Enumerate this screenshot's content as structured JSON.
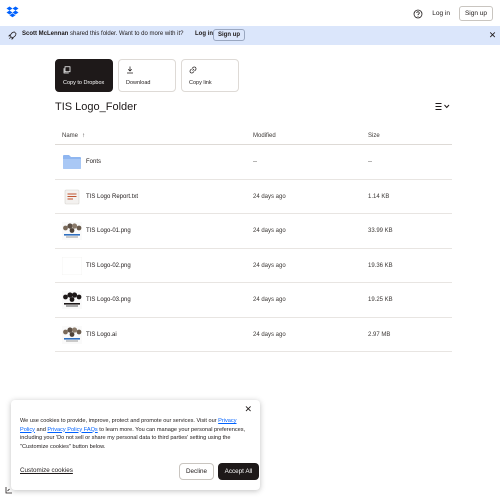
{
  "header": {
    "logo_icon": "dropbox-logo-icon",
    "help_icon": "help-circle-icon",
    "login_label": "Log in",
    "signup_label": "Sign up"
  },
  "banner": {
    "icon": "rocket-icon",
    "sharer": "Scott McLennan",
    "message": " shared this folder. Want to do more with it?",
    "login_label": "Log in",
    "signup_label": "Sign up",
    "close_icon": "close-icon",
    "background": "#dbe6fb"
  },
  "actions": [
    {
      "label": "Copy to Dropbox",
      "icon": "copy-icon"
    },
    {
      "label": "Download",
      "icon": "download-icon"
    },
    {
      "label": "Copy link",
      "icon": "link-icon"
    }
  ],
  "folder": {
    "title": "TIS Logo_Folder",
    "view_icon": "list-view-icon"
  },
  "table": {
    "columns": {
      "name": "Name",
      "modified": "Modified",
      "size": "Size"
    },
    "rows": [
      {
        "name": "Fonts",
        "modified": "--",
        "size": "--",
        "thumb": "folder"
      },
      {
        "name": "TIS Logo Report.txt",
        "modified": "24 days ago",
        "size": "1.14 KB",
        "thumb": "text-file"
      },
      {
        "name": "TIS Logo-01.png",
        "modified": "24 days ago",
        "size": "33.99 KB",
        "thumb": "logo-color"
      },
      {
        "name": "TIS Logo-02.png",
        "modified": "24 days ago",
        "size": "19.36 KB",
        "thumb": "blank"
      },
      {
        "name": "TIS Logo-03.png",
        "modified": "24 days ago",
        "size": "19.25 KB",
        "thumb": "logo-dark"
      },
      {
        "name": "TIS Logo.ai",
        "modified": "24 days ago",
        "size": "2.97 MB",
        "thumb": "logo-color"
      }
    ]
  },
  "cookie": {
    "text_1": "We use cookies to provide, improve, protect and promote our services. Visit our ",
    "link_1": "Privacy Policy",
    "text_2": " and ",
    "link_2": "Privacy Policy FAQs",
    "text_3": " to learn more. You can manage your personal preferences, including your 'Do not sell or share my personal data to third parties' setting using the \"Customize cookies\" button below.",
    "customize_label": "Customize cookies",
    "decline_label": "Decline",
    "accept_label": "Accept All"
  },
  "colors": {
    "accent": "#0061fe",
    "dark": "#1e1919",
    "folder": "#8fb6f0"
  }
}
